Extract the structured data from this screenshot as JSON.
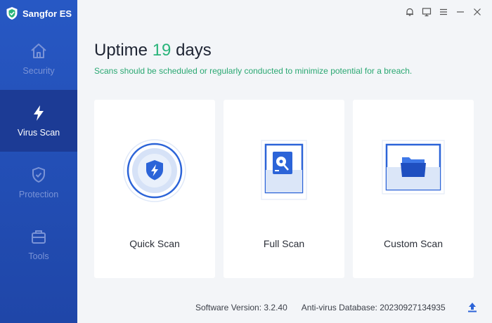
{
  "app": {
    "title": "Sangfor ES"
  },
  "titlebar": {
    "icons": [
      "bell-icon",
      "monitor-icon",
      "menu-icon",
      "minimize-icon",
      "close-icon"
    ]
  },
  "sidebar": {
    "items": [
      {
        "label": "Security",
        "icon": "home-icon",
        "active": false
      },
      {
        "label": "Virus Scan",
        "icon": "lightning-icon",
        "active": true
      },
      {
        "label": "Protection",
        "icon": "shield-check-icon",
        "active": false
      },
      {
        "label": "Tools",
        "icon": "toolbox-icon",
        "active": false
      }
    ]
  },
  "main": {
    "uptime_prefix": "Uptime",
    "uptime_days": "19",
    "uptime_suffix": "days",
    "subtitle": "Scans should be scheduled or regularly conducted to minimize potential for a breach.",
    "cards": [
      {
        "label": "Quick Scan",
        "icon": "shield-lightning-icon"
      },
      {
        "label": "Full Scan",
        "icon": "disk-scan-icon"
      },
      {
        "label": "Custom Scan",
        "icon": "folder-icon"
      }
    ]
  },
  "footer": {
    "version_label": "Software Version:",
    "version": "3.2.40",
    "db_label": "Anti-virus Database:",
    "db_version": "20230927134935",
    "upload_icon": "upload-icon"
  },
  "colors": {
    "sidebar": "#2758c4",
    "sidebar_active": "#1c3b95",
    "accent_green": "#2ab47a",
    "brand_blue": "#2c64d8"
  }
}
